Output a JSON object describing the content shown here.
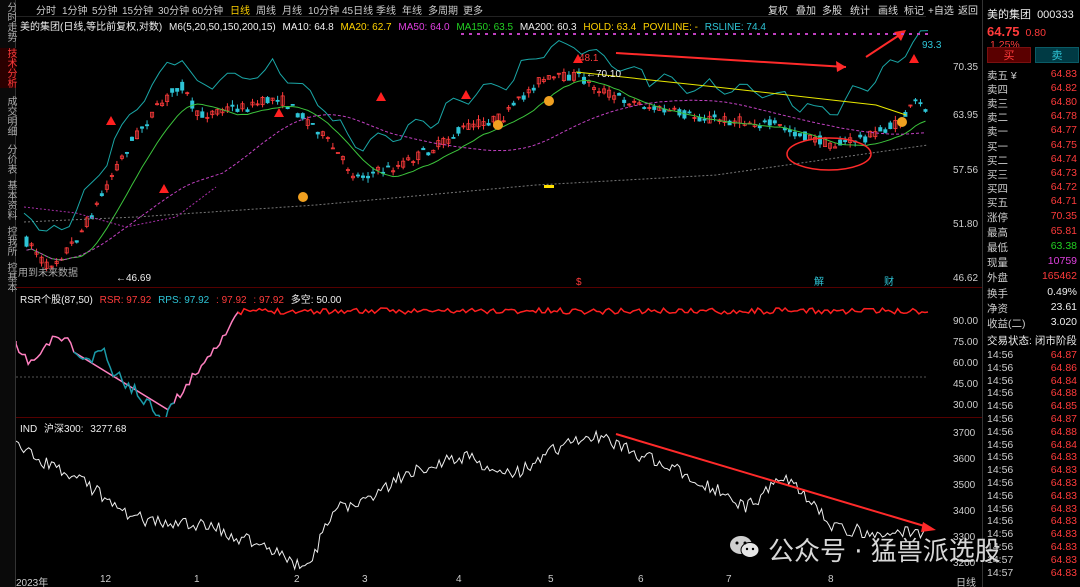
{
  "left_tabs": [
    {
      "label": "分时走势",
      "active": false
    },
    {
      "label": "技术分析",
      "active": true
    },
    {
      "label": "成交明细",
      "active": false
    },
    {
      "label": "分价表",
      "active": false
    },
    {
      "label": "基本资料",
      "active": false
    },
    {
      "label": "控我所",
      "active": false
    },
    {
      "label": "控基本",
      "active": false
    }
  ],
  "periods": [
    "分时",
    "1分钟",
    "5分钟",
    "15分钟",
    "30分钟",
    "60分钟",
    "日线",
    "周线",
    "月线",
    "10分钟",
    "45日线",
    "季线",
    "年线",
    "多周期",
    "更多"
  ],
  "active_period": "日线",
  "tools": [
    "复权",
    "叠加",
    "多股",
    "统计",
    "画线",
    "标记",
    "+自选",
    "返回"
  ],
  "main_legend": {
    "title": "美的集团(日线,等比前复权,对数)",
    "m6": "M6(5,20,50,150,200,15)",
    "ma10": "MA10: 64.8",
    "ma20": "MA20: 62.7",
    "ma50": "MA50: 64.0",
    "ma150": "MA150: 63.5",
    "ma200": "MA200: 60.3",
    "hold": "HOLD: 63.4",
    "poviline": "POVILINE: -",
    "rsline": "RSLINE: 74.4"
  },
  "main_axis": [
    "70.35",
    "63.95",
    "57.56",
    "51.80",
    "46.62"
  ],
  "main_annotations": {
    "high": "48.1",
    "mid": "70.10",
    "low": "46.69",
    "rsline_end": "93.3",
    "future_label": "用到未来数据",
    "markers": [
      "$",
      "解",
      "财"
    ]
  },
  "rsr_legend": {
    "title": "RSR个股(87,50)",
    "rsr": "RSR: 97.92",
    "rps": "RPS: 97.92",
    "v1": ": 97.92",
    "v2": ": 97.92",
    "v3": "多空: 50.00"
  },
  "rsr_axis": [
    "90.00",
    "75.00",
    "60.00",
    "45.00",
    "30.00"
  ],
  "ind_legend": {
    "title": "IND",
    "name": "沪深300:",
    "value": "3277.68"
  },
  "ind_axis": [
    "3700",
    "3600",
    "3500",
    "3400",
    "3300",
    "3200"
  ],
  "x_axis": [
    "2023年",
    "12",
    "1",
    "2",
    "3",
    "4",
    "5",
    "6",
    "7",
    "8"
  ],
  "x_axis_right": "日线",
  "stock": {
    "name": "美的集团",
    "code": "000333",
    "price": "64.75",
    "change": "0.80",
    "pct": "1.25%",
    "buy_btn": "买",
    "sell_btn": "卖"
  },
  "ask": [
    {
      "label": "卖五 ¥",
      "price": "64.83"
    },
    {
      "label": "卖四",
      "price": "64.82"
    },
    {
      "label": "卖三",
      "price": "64.80"
    },
    {
      "label": "卖二",
      "price": "64.78"
    },
    {
      "label": "卖一",
      "price": "64.77"
    }
  ],
  "bid": [
    {
      "label": "买一",
      "price": "64.75"
    },
    {
      "label": "买二",
      "price": "64.74"
    },
    {
      "label": "买三",
      "price": "64.73"
    },
    {
      "label": "买四",
      "price": "64.72"
    },
    {
      "label": "买五",
      "price": "64.71"
    }
  ],
  "stats": [
    {
      "label": "涨停",
      "value": "70.35",
      "cls": "red"
    },
    {
      "label": "最高",
      "value": "65.81",
      "cls": "red"
    },
    {
      "label": "最低",
      "value": "63.38",
      "cls": "green"
    },
    {
      "label": "现量",
      "value": "10759",
      "cls": "magenta"
    },
    {
      "label": "外盘",
      "value": "165462",
      "cls": "red"
    },
    {
      "label": "换手",
      "value": "0.49%",
      "cls": "white"
    },
    {
      "label": "净资",
      "value": "23.61",
      "cls": "white"
    },
    {
      "label": "收益(二)",
      "value": "3.020",
      "cls": "white"
    }
  ],
  "trade_status": "交易状态: 闭市阶段",
  "ticks": [
    {
      "t": "14:56",
      "p": "64.87"
    },
    {
      "t": "14:56",
      "p": "64.86"
    },
    {
      "t": "14:56",
      "p": "64.84"
    },
    {
      "t": "14:56",
      "p": "64.88"
    },
    {
      "t": "14:56",
      "p": "64.85"
    },
    {
      "t": "14:56",
      "p": "64.87"
    },
    {
      "t": "14:56",
      "p": "64.88"
    },
    {
      "t": "14:56",
      "p": "64.84"
    },
    {
      "t": "14:56",
      "p": "64.83"
    },
    {
      "t": "14:56",
      "p": "64.83"
    },
    {
      "t": "14:56",
      "p": "64.83"
    },
    {
      "t": "14:56",
      "p": "64.83"
    },
    {
      "t": "14:56",
      "p": "64.83"
    },
    {
      "t": "14:56",
      "p": "64.83"
    },
    {
      "t": "14:56",
      "p": "64.83"
    },
    {
      "t": "14:56",
      "p": "64.83"
    },
    {
      "t": "14:57",
      "p": "64.83"
    },
    {
      "t": "14:57",
      "p": "64.83"
    }
  ],
  "watermark": "公众号 · 猛兽派选股",
  "colors": {
    "up": "#ff3b3b",
    "down": "#2ec4d6",
    "ma_yellow": "#e8e800",
    "ma_green": "#3cc43c",
    "ma_magenta": "#c040c0",
    "rsline": "#1aa7a7"
  }
}
